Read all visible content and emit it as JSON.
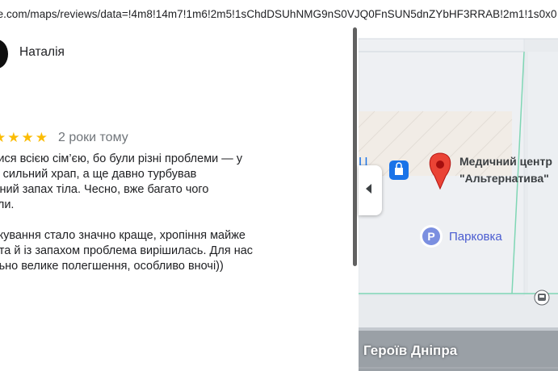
{
  "browser": {
    "url_text": "gle.com/maps/reviews/data=!4m8!14m7!1m6!2m5!1sChdDSUhNMG9nS0VJQ0FnSUN5dnZYbHF3RRAB!2m1!1s0x0"
  },
  "review": {
    "author_name": "Наталія",
    "stars_text": "★★★★",
    "time_ago": "2 роки тому",
    "text": "нулися всією сім’єю, бо були різні проблеми — у\nвіка сильний храп, а ще давно турбував\nиємний запах тіла. Чесно, вже багато чого\nували.\n\nя лікування стало значно краще, хропіння майже\nло, та й із запахом проблема вирішилась. Для нас\nеально велике полегшення, особливо вночі))",
    "rating": 5
  },
  "map": {
    "poi_name_line1": "Медичний центр",
    "poi_name_line2": "\"Альтернатива\"",
    "parking_label": "Парковка",
    "street_label": "Героїв Дніпра",
    "partial_label": "Ц",
    "colors": {
      "pin": "#ea4335",
      "parking": "#7b8fe0",
      "shop_icon": "#1a73e8"
    }
  },
  "icons": {
    "map_pin": "map-pin-icon",
    "parking": "parking-icon",
    "shop": "shopping-bag-icon",
    "bus": "bus-stop-icon",
    "collapse": "chevron-left-icon"
  }
}
